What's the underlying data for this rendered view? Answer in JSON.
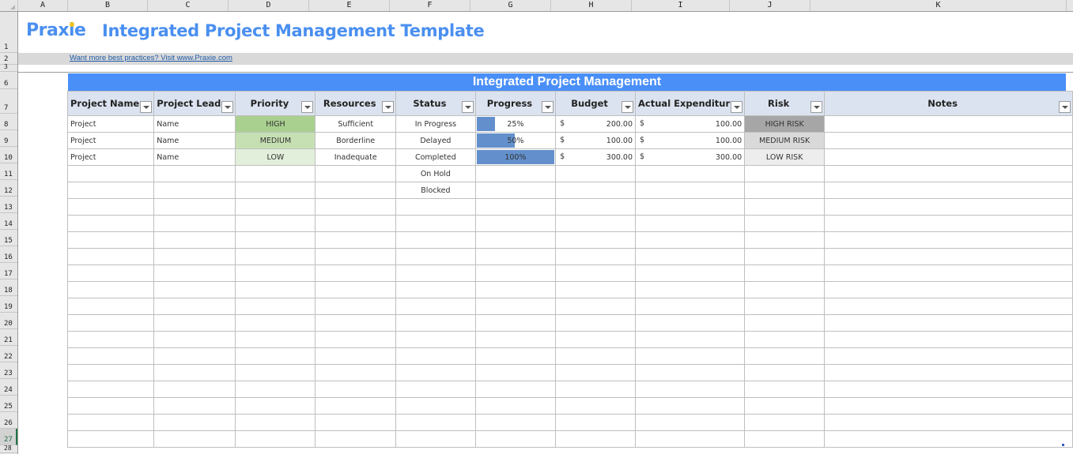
{
  "columns": [
    "A",
    "B",
    "C",
    "D",
    "E",
    "F",
    "G",
    "H",
    "I",
    "J",
    "K"
  ],
  "rows": [
    "1",
    "2",
    "3",
    "6",
    "7",
    "8",
    "9",
    "10",
    "11",
    "12",
    "13",
    "14",
    "15",
    "16",
    "17",
    "18",
    "19",
    "20",
    "21",
    "22",
    "23",
    "24",
    "25",
    "26",
    "27",
    "28"
  ],
  "selected_row": "27",
  "header": {
    "logo": "Praxie",
    "title": "Integrated Project Management Template",
    "link": "Want more best practices? Visit www.Praxie.com"
  },
  "table": {
    "banner": "Integrated Project Management",
    "headers": [
      "Project Name",
      "Project Lead",
      "Priority",
      "Resources",
      "Status",
      "Progress",
      "Budget",
      "Actual Expenditur",
      "Risk",
      "Notes"
    ],
    "rows": [
      {
        "project": "Project",
        "lead": "Name",
        "priority": "HIGH",
        "resources": "Sufficient",
        "status": "In Progress",
        "progress": 0.25,
        "progress_label": "25%",
        "budget_cur": "$",
        "budget": "200.00",
        "actual_cur": "$",
        "actual": "100.00",
        "risk": "HIGH RISK",
        "notes": ""
      },
      {
        "project": "Project",
        "lead": "Name",
        "priority": "MEDIUM",
        "resources": "Borderline",
        "status": "Delayed",
        "progress": 0.5,
        "progress_label": "50%",
        "budget_cur": "$",
        "budget": "100.00",
        "actual_cur": "$",
        "actual": "100.00",
        "risk": "MEDIUM RISK",
        "notes": ""
      },
      {
        "project": "Project",
        "lead": "Name",
        "priority": "LOW",
        "resources": "Inadequate",
        "status": "Completed",
        "progress": 1.0,
        "progress_label": "100%",
        "budget_cur": "$",
        "budget": "300.00",
        "actual_cur": "$",
        "actual": "300.00",
        "risk": "LOW RISK",
        "notes": ""
      }
    ],
    "extra_status": [
      "On Hold",
      "Blocked"
    ],
    "empty_rows": 15
  },
  "colors": {
    "brand": "#4a8ff0",
    "banner": "#4a8ff8",
    "header_bg": "#dce3f0",
    "progress_bar": "#6390cc",
    "priority_high": "#a9d08e",
    "priority_medium": "#c6e0b4",
    "priority_low": "#e2efda",
    "risk_high": "#a6a6a6",
    "risk_medium": "#d9d9d9",
    "risk_low": "#ededed"
  }
}
